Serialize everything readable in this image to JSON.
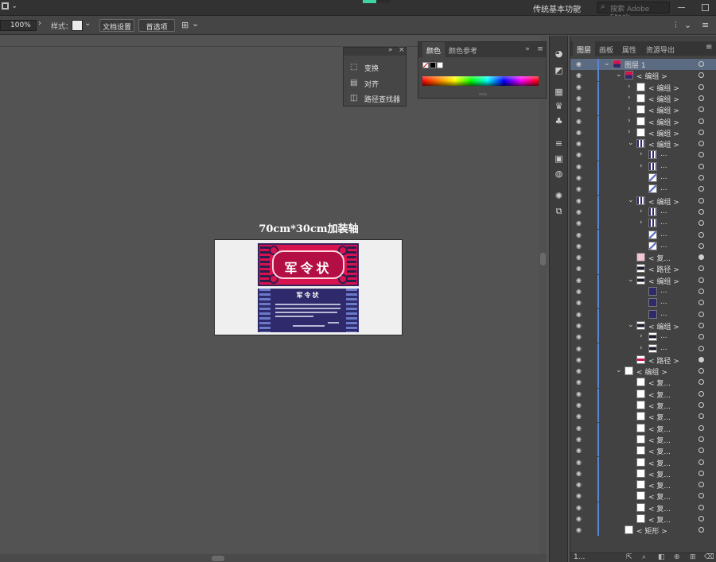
{
  "topbar": {
    "workspace_label": "传统基本功能",
    "search_placeholder": "搜索 Adobe Stock",
    "progress_fraction": 0.5
  },
  "controlbar": {
    "zoom_value": "100%",
    "style_label": "样式：",
    "doc_setup_label": "文档设置",
    "prefs_label": "首选项"
  },
  "canvas": {
    "artboard_title": "70cm*30cm加装轴",
    "banner_top_heading": "军令状",
    "banner_bottom_heading": "军令状"
  },
  "float_panel": {
    "items": [
      {
        "label": "变换",
        "icon": "transform-icon"
      },
      {
        "label": "对齐",
        "icon": "align-icon"
      },
      {
        "label": "路径查找器",
        "icon": "pathfinder-icon"
      }
    ]
  },
  "color_panel": {
    "tabs": [
      "颜色",
      "颜色参考"
    ],
    "active_tab": "颜色"
  },
  "layers_panel": {
    "tabs": [
      "图层",
      "画板",
      "属性",
      "资源导出"
    ],
    "active_tab": "图层",
    "footer_count": "1...",
    "rows": [
      {
        "name": "图层 1",
        "indent": 0,
        "toggle": "v",
        "thumb": "art",
        "selected": true,
        "target_filled": false
      },
      {
        "name": "< 编组 >",
        "indent": 1,
        "toggle": "v",
        "thumb": "art",
        "selected": false,
        "target_filled": false
      },
      {
        "name": "< 编组 >",
        "indent": 2,
        "toggle": ">",
        "thumb": "white",
        "selected": false,
        "target_filled": false
      },
      {
        "name": "< 编组 >",
        "indent": 2,
        "toggle": ">",
        "thumb": "white",
        "selected": false,
        "target_filled": false
      },
      {
        "name": "< 编组 >",
        "indent": 2,
        "toggle": ">",
        "thumb": "white",
        "selected": false,
        "target_filled": false
      },
      {
        "name": "< 编组 >",
        "indent": 2,
        "toggle": ">",
        "thumb": "white",
        "selected": false,
        "target_filled": false
      },
      {
        "name": "< 编组 >",
        "indent": 2,
        "toggle": ">",
        "thumb": "white",
        "selected": false,
        "target_filled": false
      },
      {
        "name": "< 编组 >",
        "indent": 2,
        "toggle": "v",
        "thumb": "pattern",
        "selected": false,
        "target_filled": false
      },
      {
        "name": "...",
        "indent": 3,
        "toggle": ">",
        "thumb": "pattern",
        "selected": false,
        "target_filled": false
      },
      {
        "name": "...",
        "indent": 3,
        "toggle": ">",
        "thumb": "pattern",
        "selected": false,
        "target_filled": false
      },
      {
        "name": "...",
        "indent": 3,
        "toggle": "",
        "thumb": "stripe",
        "selected": false,
        "target_filled": false
      },
      {
        "name": "...",
        "indent": 3,
        "toggle": "",
        "thumb": "stripe",
        "selected": false,
        "target_filled": false
      },
      {
        "name": "< 编组 >",
        "indent": 2,
        "toggle": "v",
        "thumb": "pattern",
        "selected": false,
        "target_filled": false
      },
      {
        "name": "...",
        "indent": 3,
        "toggle": ">",
        "thumb": "pattern",
        "selected": false,
        "target_filled": false
      },
      {
        "name": "...",
        "indent": 3,
        "toggle": ">",
        "thumb": "pattern",
        "selected": false,
        "target_filled": false
      },
      {
        "name": "...",
        "indent": 3,
        "toggle": "",
        "thumb": "stripe",
        "selected": false,
        "target_filled": false
      },
      {
        "name": "...",
        "indent": 3,
        "toggle": "",
        "thumb": "stripe",
        "selected": false,
        "target_filled": false
      },
      {
        "name": "< 复...",
        "indent": 2,
        "toggle": "",
        "thumb": "pink",
        "selected": false,
        "target_filled": true
      },
      {
        "name": "< 路径 >",
        "indent": 2,
        "toggle": "",
        "thumb": "dark",
        "selected": false,
        "target_filled": false
      },
      {
        "name": "< 编组 >",
        "indent": 2,
        "toggle": "v",
        "thumb": "dark",
        "selected": false,
        "target_filled": false
      },
      {
        "name": "...",
        "indent": 3,
        "toggle": "",
        "thumb": "navy",
        "selected": false,
        "target_filled": false
      },
      {
        "name": "...",
        "indent": 3,
        "toggle": "",
        "thumb": "navy",
        "selected": false,
        "target_filled": false
      },
      {
        "name": "...",
        "indent": 3,
        "toggle": "",
        "thumb": "navy",
        "selected": false,
        "target_filled": false
      },
      {
        "name": "< 编组 >",
        "indent": 2,
        "toggle": "v",
        "thumb": "dark",
        "selected": false,
        "target_filled": false
      },
      {
        "name": "...",
        "indent": 3,
        "toggle": ">",
        "thumb": "dark",
        "selected": false,
        "target_filled": false
      },
      {
        "name": "...",
        "indent": 3,
        "toggle": ">",
        "thumb": "dark",
        "selected": false,
        "target_filled": false
      },
      {
        "name": "< 路径 >",
        "indent": 2,
        "toggle": "",
        "thumb": "red",
        "selected": false,
        "target_filled": true
      },
      {
        "name": "< 编组 >",
        "indent": 1,
        "toggle": "v",
        "thumb": "white",
        "selected": false,
        "target_filled": false
      },
      {
        "name": "< 复...",
        "indent": 2,
        "toggle": "",
        "thumb": "white",
        "selected": false,
        "target_filled": false
      },
      {
        "name": "< 复...",
        "indent": 2,
        "toggle": "",
        "thumb": "white",
        "selected": false,
        "target_filled": false
      },
      {
        "name": "< 复...",
        "indent": 2,
        "toggle": "",
        "thumb": "white",
        "selected": false,
        "target_filled": false
      },
      {
        "name": "< 复...",
        "indent": 2,
        "toggle": "",
        "thumb": "white",
        "selected": false,
        "target_filled": false
      },
      {
        "name": "< 复...",
        "indent": 2,
        "toggle": "",
        "thumb": "white",
        "selected": false,
        "target_filled": false
      },
      {
        "name": "< 复...",
        "indent": 2,
        "toggle": "",
        "thumb": "white",
        "selected": false,
        "target_filled": false
      },
      {
        "name": "< 复...",
        "indent": 2,
        "toggle": "",
        "thumb": "white",
        "selected": false,
        "target_filled": false
      },
      {
        "name": "< 复...",
        "indent": 2,
        "toggle": "",
        "thumb": "white",
        "selected": false,
        "target_filled": false
      },
      {
        "name": "< 复...",
        "indent": 2,
        "toggle": "",
        "thumb": "white",
        "selected": false,
        "target_filled": false
      },
      {
        "name": "< 复...",
        "indent": 2,
        "toggle": "",
        "thumb": "white",
        "selected": false,
        "target_filled": false
      },
      {
        "name": "< 复...",
        "indent": 2,
        "toggle": "",
        "thumb": "white",
        "selected": false,
        "target_filled": false
      },
      {
        "name": "< 复...",
        "indent": 2,
        "toggle": "",
        "thumb": "white",
        "selected": false,
        "target_filled": false
      },
      {
        "name": "< 复...",
        "indent": 2,
        "toggle": "",
        "thumb": "white",
        "selected": false,
        "target_filled": false
      },
      {
        "name": "< 矩形 >",
        "indent": 1,
        "toggle": "",
        "thumb": "white",
        "selected": false,
        "target_filled": false
      }
    ]
  },
  "colors": {
    "accent_selection": "#5b6b82",
    "layer_bar": "#5a87d8",
    "banner_red": "#d6134f",
    "banner_navy": "#2f2a6b",
    "progress": "#3fd3a3"
  }
}
